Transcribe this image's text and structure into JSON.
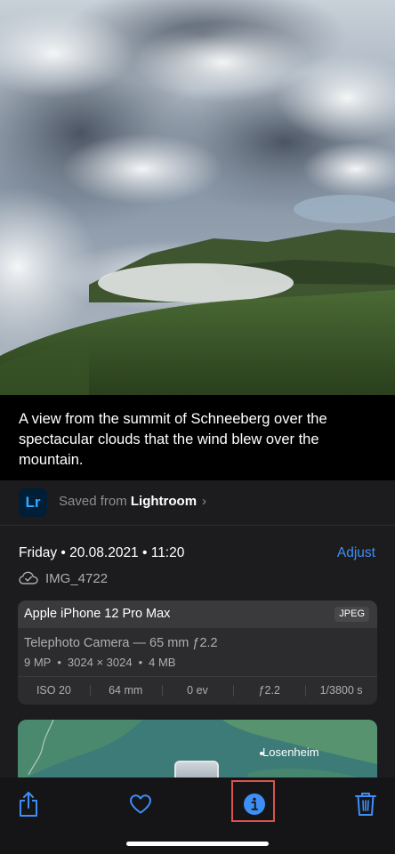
{
  "photo": {
    "subject": "mountain-clouds-photo"
  },
  "caption": {
    "text": "A view from the summit of Schneeberg over the spectacular clouds that the wind blew over the mountain."
  },
  "source": {
    "app_icon_label": "Lr",
    "prefix": "Saved from ",
    "app_name": "Lightroom",
    "chevron": "›"
  },
  "meta": {
    "date_line": "Friday • 20.08.2021 • 11:20",
    "adjust_label": "Adjust",
    "filename": "IMG_4722",
    "cloud_icon": "cloud-check-icon"
  },
  "camera": {
    "model": "Apple iPhone 12 Pro Max",
    "format_badge": "JPEG",
    "lens": "Telephoto Camera — 65 mm ƒ2.2",
    "specs": [
      "9 MP",
      "3024 × 3024",
      "4 MB"
    ],
    "spec_separator": "•",
    "exif": [
      "ISO 20",
      "64 mm",
      "0 ev",
      "ƒ2.2",
      "1/3800 s"
    ]
  },
  "map": {
    "place_label": "Losenheim"
  },
  "toolbar": {
    "share_icon": "share-icon",
    "favorite_icon": "heart-icon",
    "info_icon": "info-icon",
    "delete_icon": "trash-icon"
  },
  "colors": {
    "accent": "#3d8ff7",
    "panel_bg": "#1c1c1e",
    "card_bg": "#2c2c2e",
    "highlight": "#d9534f"
  }
}
